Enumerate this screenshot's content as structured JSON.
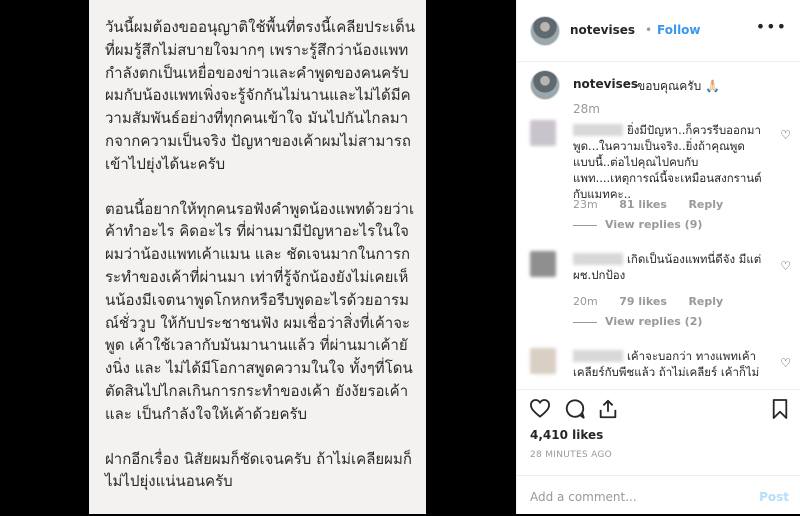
{
  "post_image": {
    "paragraphs": [
      "วันนี้ผมต้องขออนุญาติใช้พื้นที่ตรงนี้เคลียประเด็นที่ผมรู้สึกไม่สบายใจมากๆ เพราะรู้สึกว่าน้องแพทกำลังตกเป็นเหยื่อของข่าวและคำพูดของคนครับ ผมกับน้องแพทเพิ่งจะรู้จักกันไม่นานและไม่ได้มีความสัมพันธ์อย่างที่ทุกคนเข้าใจ มันไปกันไกลมากจากความเป็นจริง ปัญหาของเค้าผมไม่สามารถเข้าไปยุ่งได้นะครับ",
      "ตอนนี้อยากให้ทุกคนรอฟังคำพูดน้องแพทด้วยว่าเค้าทำอะไร คิดอะไร ที่ผ่านมามีปัญหาอะไรในใจ ผมว่าน้องแพทเค้าแมน และ ชัดเจนมากในการกระทำของเค้าที่ผ่านมา เท่าที่รู้จักน้องยังไม่เคยเห็นน้องมีเจตนาพูดโกหกหรือรีบพูดอะไรด้วยอารมณ์ชั่ววูบ ให้กับประชาชนฟัง ผมเชื่อว่าสิ่งที่เค้าจะพูด เค้าใช้เวลากับมันมานานแล้ว ที่ผ่านมาเค้ายังนิ่ง และ ไม่ได้มีโอกาสพูดความในใจ ทั้งๆที่โดนตัดสินไปไกลเกินการกระทำของเค้า ยังงัยรอเค้า และ เป็นกำลังใจให้เค้าด้วยครับ",
      "ฝากอีกเรื่อง นิสัยผมก็ชัดเจนครับ ถ้าไม่เคลียผมก็ไม่ไปยุ่งแน่นอนครับ"
    ]
  },
  "header": {
    "username": "notevises",
    "separator": "•",
    "follow_label": "Follow",
    "more_icon": "more-horizontal-icon",
    "more_glyph": "•••"
  },
  "caption": {
    "username": "notevises",
    "text": "ขอบคุณครับ 🙏🏻",
    "time": "28m"
  },
  "comments": [
    {
      "text": "ยิ่งมีปัญหา..ก็ควรรีบออกมาพูด...ในความเป็นจริง..ยิ่งถ้าคุณพูดแบบนี้..ต่อไปคุณไปคบกับแพท....เหตุการณ์นี้จะเหมือนสงกรานต์กับแมทคะ..",
      "time": "23m",
      "likes": "81 likes",
      "reply_label": "Reply",
      "view_replies": "View replies (9)",
      "avatar_color": "#c9c4cc"
    },
    {
      "text": "เกิดเป็นน้องแพทนี่ดีจัง มีแต่ผช.ปกป้อง",
      "time": "20m",
      "likes": "79 likes",
      "reply_label": "Reply",
      "view_replies": "View replies (2)",
      "avatar_color": "#8f8f8f"
    },
    {
      "text": "เค้าจะบอกว่า ทางแพทเค้าเคลียร์กับพีชแล้ว ถ้าไม่เคลียร์ เค้าก็ไม่",
      "avatar_color": "#d9cfc4"
    }
  ],
  "heart_glyph": "♡",
  "actions": {
    "like_icon": "heart-icon",
    "comment_icon": "comment-icon",
    "share_icon": "share-icon",
    "save_icon": "bookmark-icon"
  },
  "likes_count": "4,410 likes",
  "time_ago": "28 MINUTES AGO",
  "add_comment": {
    "placeholder": "Add a comment...",
    "post_label": "Post"
  },
  "colors": {
    "accent": "#3897f0",
    "post_disabled": "#b2dffc",
    "muted": "#999999"
  }
}
